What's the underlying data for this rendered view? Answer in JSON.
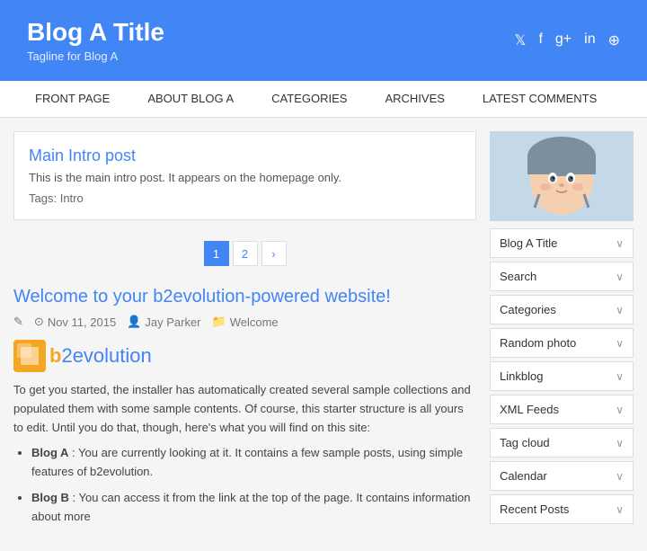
{
  "header": {
    "title": "Blog A Title",
    "tagline": "Tagline for Blog A",
    "icons": [
      "twitter",
      "facebook",
      "googleplus",
      "linkedin",
      "flickr"
    ]
  },
  "nav": {
    "items": [
      {
        "label": "FRONT PAGE",
        "active": false
      },
      {
        "label": "ABOUT BLOG A",
        "active": false
      },
      {
        "label": "CATEGORIES",
        "active": false
      },
      {
        "label": "ARCHIVES",
        "active": false
      },
      {
        "label": "LATEST COMMENTS",
        "active": false
      }
    ]
  },
  "intro_post": {
    "title": "Main Intro post",
    "body": "This is the main intro post. It appears on the homepage only.",
    "tags_label": "Tags:",
    "tags": "Intro"
  },
  "pagination": {
    "pages": [
      "1",
      "2"
    ],
    "next": "›"
  },
  "post": {
    "title": "Welcome to your b2evolution-powered website!",
    "meta": {
      "date": "Nov 11, 2015",
      "author": "Jay Parker",
      "category": "Welcome"
    },
    "logo_b": "b",
    "logo_text": "2evolution",
    "body_intro": "To get you started, the installer has automatically created several sample collections and populated them with some sample contents. Of course, this starter structure is all yours to edit. Until you do that, though, here's what you will find on this site:",
    "list_items": [
      {
        "name": "Blog A",
        "text": ": You are currently looking at it. It contains a few sample posts, using simple features of b2evolution."
      },
      {
        "name": "Blog B",
        "text": ": You can access it from the link at the top of the page. It contains information about more"
      }
    ]
  },
  "sidebar": {
    "widgets": [
      {
        "label": "Blog A Title"
      },
      {
        "label": "Search"
      },
      {
        "label": "Categories"
      },
      {
        "label": "Random photo"
      },
      {
        "label": "Linkblog"
      },
      {
        "label": "XML Feeds"
      },
      {
        "label": "Tag cloud"
      },
      {
        "label": "Calendar"
      },
      {
        "label": "Recent Posts"
      }
    ]
  }
}
